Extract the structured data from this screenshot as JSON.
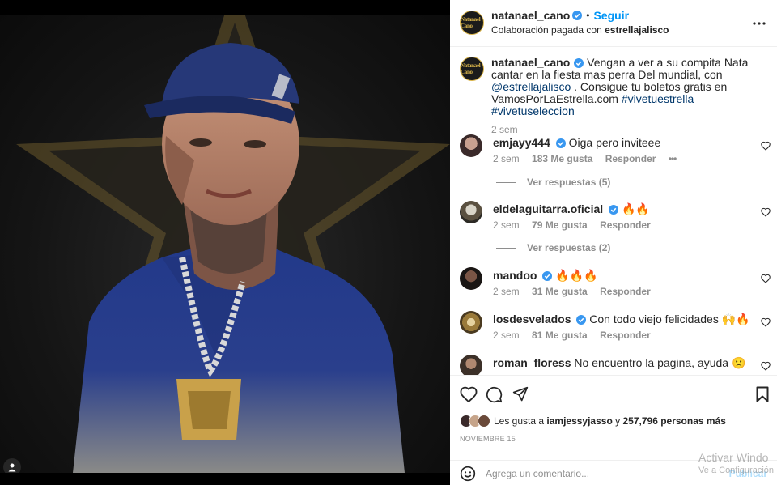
{
  "post": {
    "author": "natanael_cano",
    "follow_label": "Seguir",
    "separator": "•",
    "subtitle_prefix": "Colaboración pagada con",
    "partner": "estrellajalisco",
    "avatar_logo_text": "Natanael Cano"
  },
  "caption": {
    "author": "natanael_cano",
    "text_part1": "Vengan a ver a su compita Nata cantar en la fiesta mas perra Del mundial, con",
    "mention": "@estrellajalisco",
    "text_part2": ". Consigue tu boletos gratis en VamosPorLaEstrella.com",
    "hashtag1": "#vivetuestrella",
    "hashtag2": "#vivetuseleccion",
    "time": "2 sem"
  },
  "comments": [
    {
      "user": "emjayy444",
      "text": "Oiga pero inviteee",
      "time": "2 sem",
      "likes": "183 Me gusta",
      "reply": "Responder",
      "more": "•••",
      "replies_label": "Ver respuestas (5)"
    },
    {
      "user": "eldelaguitarra.oficial",
      "text": "🔥🔥",
      "time": "2 sem",
      "likes": "79 Me gusta",
      "reply": "Responder",
      "replies_label": "Ver respuestas (2)"
    },
    {
      "user": "mandoo",
      "text": "🔥🔥🔥",
      "time": "2 sem",
      "likes": "31 Me gusta",
      "reply": "Responder"
    },
    {
      "user": "losdesvelados",
      "text": "Con todo viejo felicidades 🙌🔥",
      "time": "2 sem",
      "likes": "81 Me gusta",
      "reply": "Responder"
    },
    {
      "user": "roman_floress",
      "text": "No encuentro la pagina, ayuda 🙁"
    }
  ],
  "likes": {
    "prefix": "Les gusta a",
    "user": "iamjessyjasso",
    "middle": "y",
    "count": "257,796 personas más"
  },
  "date": "NOVIEMBRE 15",
  "comment_box": {
    "placeholder": "Agrega un comentario...",
    "publish_label": "Publicar"
  },
  "watermark": {
    "line1": "Activar Windo",
    "line2": "Ve a Configuración"
  },
  "colors": {
    "accent": "#0095f6",
    "verified": "#3897f0",
    "muted": "#8e8e8e",
    "link": "#00376b"
  }
}
